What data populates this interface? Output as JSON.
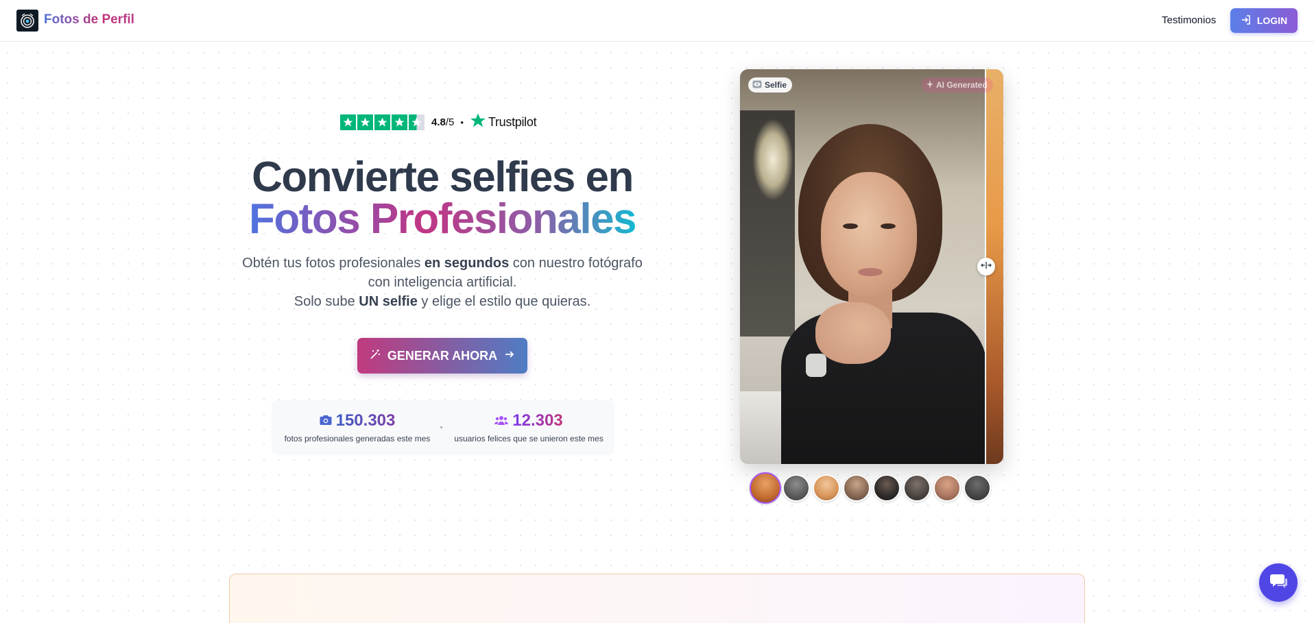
{
  "header": {
    "brand": "Fotos de Perfil",
    "nav_testimonials": "Testimonios",
    "login_label": "LOGIN"
  },
  "trustpilot": {
    "rating": "4.8",
    "rating_suffix": "/5",
    "separator": "•",
    "brand": "Trustpilot",
    "stars": 4.5
  },
  "hero": {
    "title_line1": "Convierte selfies en",
    "title_line2": "Fotos Profesionales",
    "subtitle_part1": "Obtén tus fotos profesionales ",
    "subtitle_bold1": "en segundos",
    "subtitle_part2": " con nuestro fotógrafo con inteligencia artificial.",
    "subtitle_part3": "Solo sube ",
    "subtitle_bold2": "UN selfie",
    "subtitle_part4": " y elige el estilo que quieras.",
    "cta_label": "GENERAR AHORA"
  },
  "stats": [
    {
      "number": "150.303",
      "label": "fotos profesionales generadas este mes",
      "icon": "camera-icon"
    },
    {
      "number": "12.303",
      "label": "usuarios felices que se unieron este mes",
      "icon": "users-icon"
    }
  ],
  "compare": {
    "before_label": "Selfie",
    "after_label": "AI Generated",
    "thumbnail_count": 8,
    "active_thumbnail": 0
  },
  "colors": {
    "brand_gradient_start": "#4f73e0",
    "brand_gradient_mid": "#c13584",
    "brand_gradient_end": "#14b8d1",
    "login_button": "#6d6ee0",
    "chat_button": "#4f46e5",
    "trustpilot_green": "#00b67a"
  }
}
